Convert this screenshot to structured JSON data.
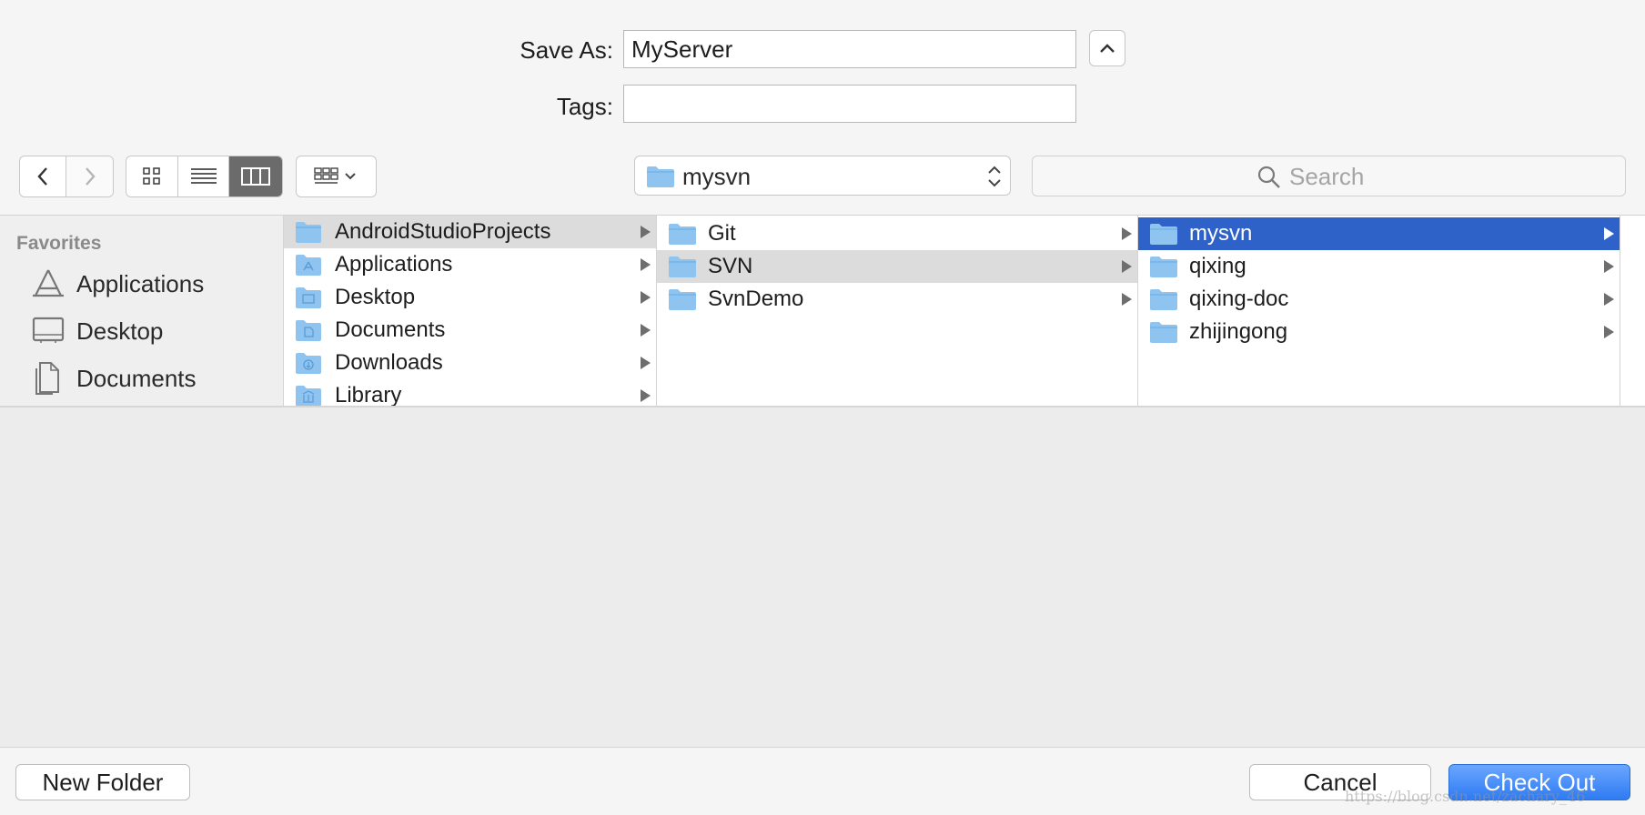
{
  "form": {
    "save_as_label": "Save As:",
    "save_as_value": "MyServer",
    "tags_label": "Tags:",
    "tags_value": ""
  },
  "toolbar": {
    "location": "mysvn",
    "search_placeholder": "Search",
    "view_modes": [
      "icon-view",
      "list-view",
      "column-view"
    ],
    "active_view": "column-view"
  },
  "sidebar": {
    "section_title": "Favorites",
    "items": [
      {
        "label": "Applications",
        "icon": "applications-icon"
      },
      {
        "label": "Desktop",
        "icon": "desktop-icon"
      },
      {
        "label": "Documents",
        "icon": "documents-icon"
      }
    ]
  },
  "columns": [
    {
      "items": [
        {
          "label": "AndroidStudioProjects",
          "state": "highlighted"
        },
        {
          "label": "Applications",
          "state": ""
        },
        {
          "label": "Desktop",
          "state": ""
        },
        {
          "label": "Documents",
          "state": ""
        },
        {
          "label": "Downloads",
          "state": ""
        },
        {
          "label": "Library",
          "state": ""
        }
      ]
    },
    {
      "items": [
        {
          "label": "Git",
          "state": ""
        },
        {
          "label": "SVN",
          "state": "highlighted"
        },
        {
          "label": "SvnDemo",
          "state": ""
        }
      ]
    },
    {
      "items": [
        {
          "label": "mysvn",
          "state": "selected"
        },
        {
          "label": "qixing",
          "state": ""
        },
        {
          "label": "qixing-doc",
          "state": ""
        },
        {
          "label": "zhijingong",
          "state": ""
        }
      ]
    }
  ],
  "footer": {
    "new_folder_label": "New Folder",
    "cancel_label": "Cancel",
    "confirm_label": "Check Out",
    "watermark": "https://blog.csdn.net/zachary_46"
  },
  "colors": {
    "selection": "#2f62c9",
    "primary_button": "#2f7bf2",
    "folder": "#8fc4f0"
  }
}
